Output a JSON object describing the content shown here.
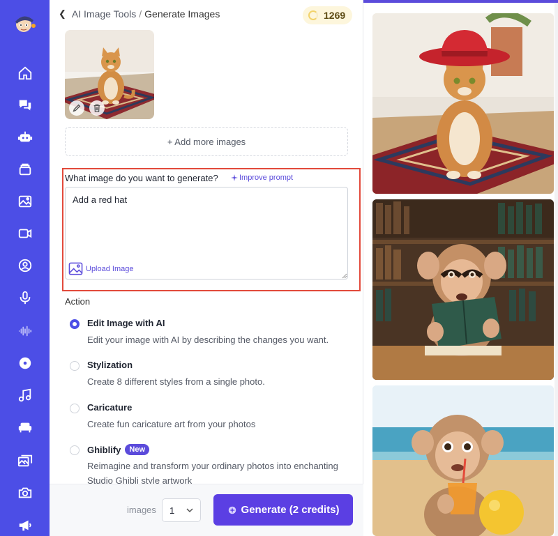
{
  "sidebar": {
    "items": [
      {
        "icon": "home-icon"
      },
      {
        "icon": "chat-icon"
      },
      {
        "icon": "robot-icon"
      },
      {
        "icon": "layers-icon"
      },
      {
        "icon": "gallery-icon"
      },
      {
        "icon": "video-icon"
      },
      {
        "icon": "user-circle-icon"
      },
      {
        "icon": "microphone-icon"
      },
      {
        "icon": "waveform-icon"
      },
      {
        "icon": "disc-icon"
      },
      {
        "icon": "music-icon"
      },
      {
        "icon": "sofa-icon"
      },
      {
        "icon": "photos-icon"
      },
      {
        "icon": "camera-icon"
      },
      {
        "icon": "megaphone-icon"
      }
    ]
  },
  "breadcrumb": {
    "parent": "AI Image Tools",
    "separator": "/",
    "current": "Generate Images"
  },
  "credits": {
    "count": "1269"
  },
  "add_more": {
    "label": "+ Add more images"
  },
  "prompt": {
    "label": "What image do you want to generate?",
    "improve_label": "Improve prompt",
    "value": "Add a red hat",
    "upload_label": "Upload Image"
  },
  "action": {
    "label": "Action",
    "options": [
      {
        "title": "Edit Image with AI",
        "desc": "Edit your image with AI by describing the changes you want.",
        "selected": true
      },
      {
        "title": "Stylization",
        "desc": "Create 8 different styles from a single photo.",
        "selected": false
      },
      {
        "title": "Caricature",
        "desc": "Create fun caricature art from your photos",
        "selected": false
      },
      {
        "title": "Ghiblify",
        "badge": "New",
        "desc": "Reimagine and transform your ordinary photos into enchanting Studio Ghibli style artwork",
        "selected": false
      }
    ]
  },
  "footer": {
    "images_label": "images",
    "images_count": "1",
    "generate_label": "Generate (2 credits)"
  },
  "colors": {
    "sidebar": "#4c4ee6",
    "accent": "#5b4bdb",
    "highlight_border": "#e24a3b",
    "generate": "#5b3fe3"
  }
}
